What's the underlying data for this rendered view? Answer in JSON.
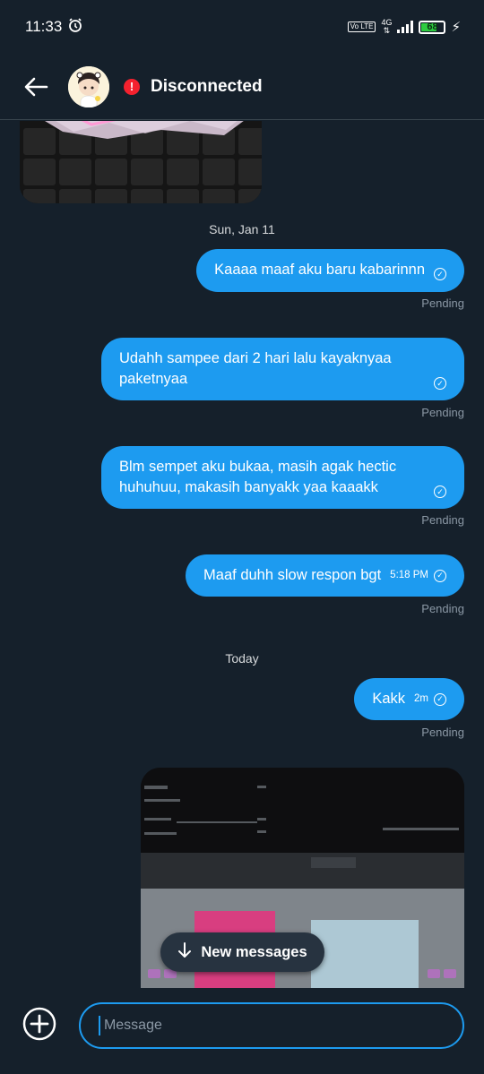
{
  "status_bar": {
    "time": "11:33",
    "network": "4G",
    "volte": "Vo LTE",
    "battery": "68"
  },
  "header": {
    "title": "Disconnected",
    "alert_symbol": "!"
  },
  "chat": {
    "dates": [
      "Sun, Jan 11",
      "Today"
    ],
    "messages": [
      {
        "text": "Kaaaa maaf aku baru kabarinnn",
        "time": "",
        "status": "Pending"
      },
      {
        "text": "Udahh sampee dari 2 hari lalu kayaknyaa paketnyaa",
        "time": "",
        "status": "Pending"
      },
      {
        "text": "Blm sempet aku bukaa, masih agak hectic huhuhuu, makasih banyakk yaa kaaakk",
        "time": "",
        "status": "Pending"
      },
      {
        "text": "Maaf duhh slow respon bgt",
        "time": "5:18 PM",
        "status": "Pending"
      },
      {
        "text": "Kakk",
        "time": "2m",
        "status": "Pending"
      }
    ],
    "new_messages_label": "New messages"
  },
  "composer": {
    "placeholder": "Message"
  },
  "colors": {
    "background": "#15202b",
    "accent": "#1d9bf0",
    "muted": "#8b98a5",
    "alert": "#f4212e"
  },
  "icons": [
    "alarm-icon",
    "back-arrow-icon",
    "alert-icon",
    "check-circle-icon",
    "arrow-down-icon",
    "add-circle-icon"
  ]
}
